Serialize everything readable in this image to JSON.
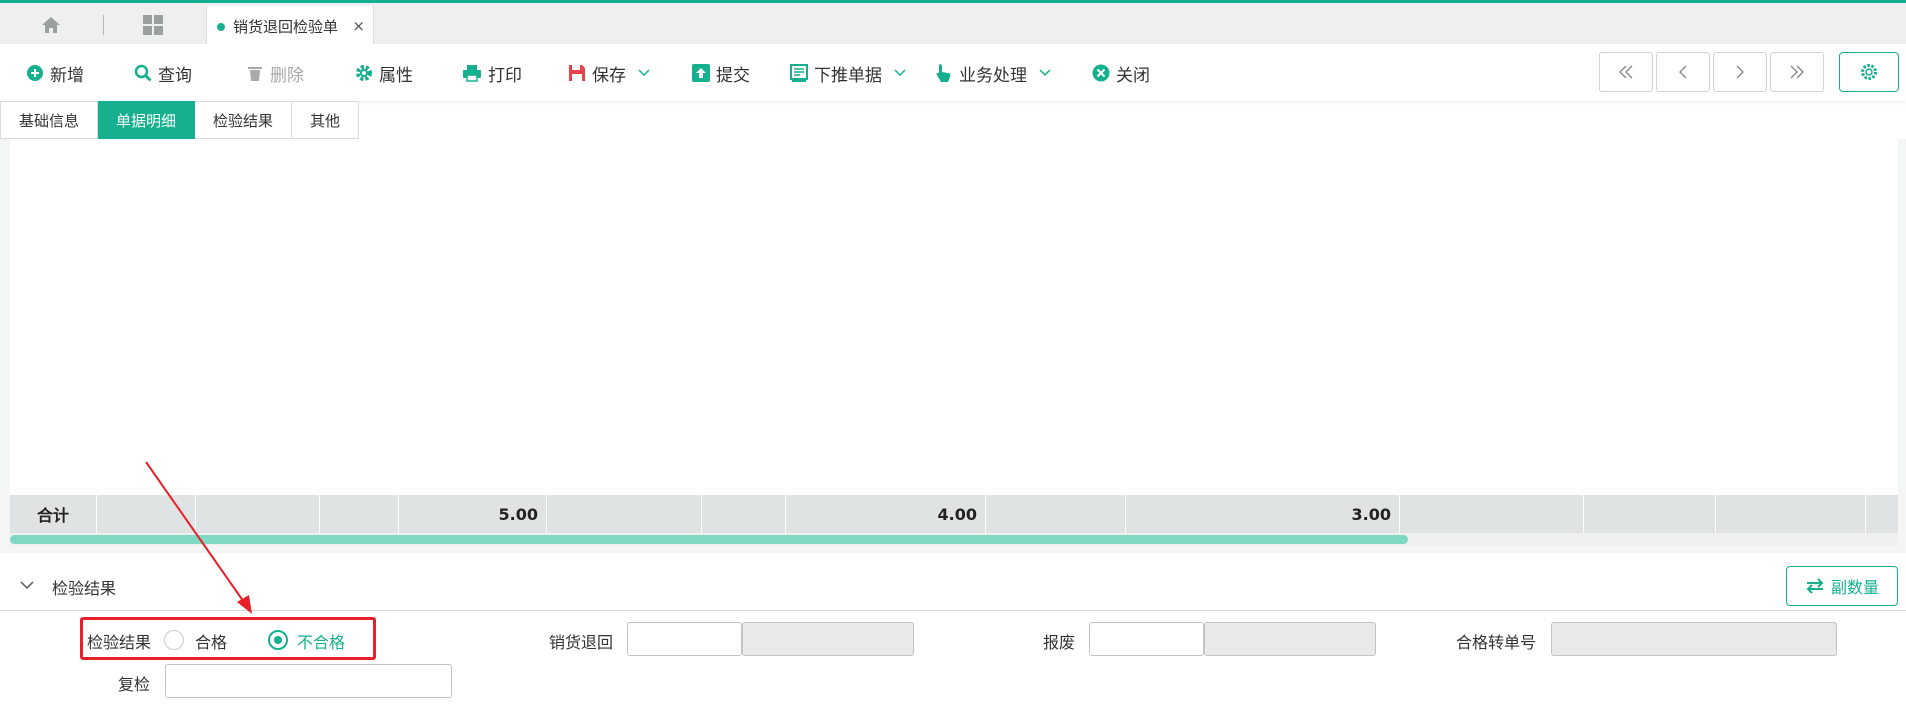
{
  "tab": {
    "title": "销货退回检验单",
    "close": "×"
  },
  "toolbar": {
    "new": "新增",
    "query": "查询",
    "delete": "删除",
    "properties": "属性",
    "print": "打印",
    "save": "保存",
    "submit": "提交",
    "push_down": "下推单据",
    "business": "业务处理",
    "close": "关闭"
  },
  "section_tabs": [
    {
      "label": "基础信息",
      "active": false
    },
    {
      "label": "单据明细",
      "active": true
    },
    {
      "label": "检验结果",
      "active": false
    },
    {
      "label": "其他",
      "active": false
    }
  ],
  "grid": {
    "total_label": "合计",
    "total_values": [
      "5.00",
      "4.00",
      "3.00"
    ]
  },
  "inspection_panel": {
    "title": "检验结果",
    "aux_button": "副数量",
    "result_label": "检验结果",
    "options": [
      {
        "label": "合格",
        "checked": false
      },
      {
        "label": "不合格",
        "checked": true
      }
    ],
    "sales_return_label": "销货退回",
    "sales_return_value": "",
    "scrap_label": "报废",
    "scrap_value": "",
    "qualified_transfer_label": "合格转单号",
    "qualified_transfer_value": "",
    "recheck_label": "复检",
    "recheck_value": ""
  },
  "colors": {
    "accent": "#16b08e",
    "highlight": "#e8202a"
  }
}
